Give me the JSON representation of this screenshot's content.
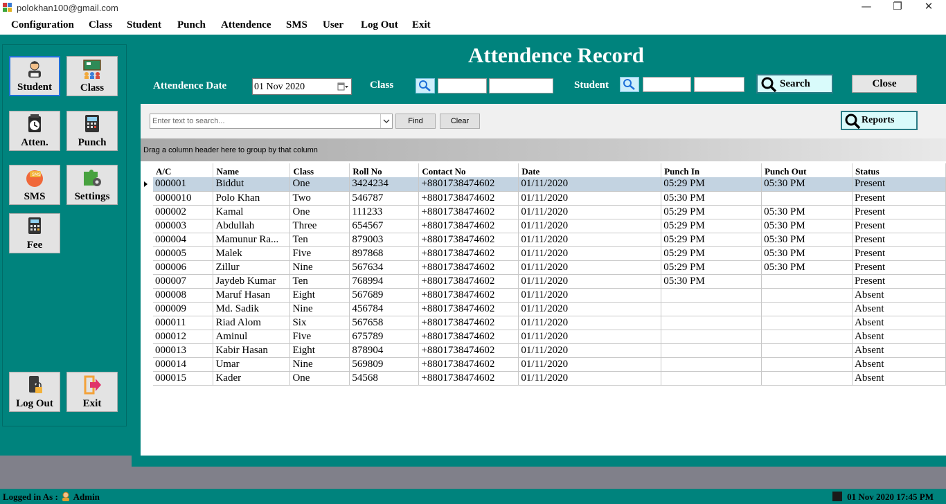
{
  "window": {
    "title": "polokhan100@gmail.com",
    "minimize": "—",
    "restore": "❐",
    "close": "✕"
  },
  "menu": [
    "Configuration",
    "Class",
    "Student",
    "Punch",
    "Attendence",
    "SMS",
    "User",
    "Log Out",
    "Exit"
  ],
  "sidebar": {
    "student": "Student",
    "class": "Class",
    "atten": "Atten.",
    "punch": "Punch",
    "sms": "SMS",
    "settings": "Settings",
    "fee": "Fee",
    "logout": "Log Out",
    "exit": "Exit"
  },
  "header": {
    "title": "Attendence Record",
    "date_label": "Attendence Date",
    "date_value": "01 Nov 2020",
    "class_label": "Class",
    "student_label": "Student",
    "search_button": "Search",
    "close_button": "Close"
  },
  "grid_toolbar": {
    "search_placeholder": "Enter text to search...",
    "find_button": "Find",
    "clear_button": "Clear",
    "reports_button": "Reports",
    "group_hint": "Drag a column header here to group by that column"
  },
  "table": {
    "columns": [
      "A/C",
      "Name",
      "Class",
      "Roll No",
      "Contact No",
      "Date",
      "Punch In",
      "Punch Out",
      "Status"
    ],
    "rows": [
      [
        "000001",
        "Biddut",
        "One",
        "3424234",
        "+8801738474602",
        "01/11/2020",
        "05:29 PM",
        "05:30 PM",
        "Present"
      ],
      [
        "0000010",
        "Polo Khan",
        "Two",
        "546787",
        "+8801738474602",
        "01/11/2020",
        "05:30 PM",
        "",
        "Present"
      ],
      [
        "000002",
        "Kamal",
        "One",
        "111233",
        "+8801738474602",
        "01/11/2020",
        "05:29 PM",
        "05:30 PM",
        "Present"
      ],
      [
        "000003",
        "Abdullah",
        "Three",
        "654567",
        "+8801738474602",
        "01/11/2020",
        "05:29 PM",
        "05:30 PM",
        "Present"
      ],
      [
        "000004",
        "Mamunur Ra...",
        "Ten",
        "879003",
        "+8801738474602",
        "01/11/2020",
        "05:29 PM",
        "05:30 PM",
        "Present"
      ],
      [
        "000005",
        "Malek",
        "Five",
        "897868",
        "+8801738474602",
        "01/11/2020",
        "05:29 PM",
        "05:30 PM",
        "Present"
      ],
      [
        "000006",
        "Zillur",
        "Nine",
        "567634",
        "+8801738474602",
        "01/11/2020",
        "05:29 PM",
        "05:30 PM",
        "Present"
      ],
      [
        "000007",
        "Jaydeb Kumar",
        "Ten",
        "768994",
        "+8801738474602",
        "01/11/2020",
        "05:30 PM",
        "",
        "Present"
      ],
      [
        "000008",
        "Maruf Hasan",
        "Eight",
        "567689",
        "+8801738474602",
        "01/11/2020",
        "",
        "",
        "Absent"
      ],
      [
        "000009",
        "Md. Sadik",
        "Nine",
        "456784",
        "+8801738474602",
        "01/11/2020",
        "",
        "",
        "Absent"
      ],
      [
        "000011",
        "Riad Alom",
        "Six",
        "567658",
        "+8801738474602",
        "01/11/2020",
        "",
        "",
        "Absent"
      ],
      [
        "000012",
        "Aminul",
        "Five",
        "675789",
        "+8801738474602",
        "01/11/2020",
        "",
        "",
        "Absent"
      ],
      [
        "000013",
        "Kabir Hasan",
        "Eight",
        "878904",
        "+8801738474602",
        "01/11/2020",
        "",
        "",
        "Absent"
      ],
      [
        "000014",
        "Umar",
        "Nine",
        "569809",
        "+8801738474602",
        "01/11/2020",
        "",
        "",
        "Absent"
      ],
      [
        "000015",
        "Kader",
        "One",
        "54568",
        "+8801738474602",
        "01/11/2020",
        "",
        "",
        "Absent"
      ]
    ]
  },
  "status": {
    "logged_in": "Logged in As : ",
    "user": "Admin",
    "datetime": "01 Nov 2020 17:45 PM"
  },
  "colors": {
    "teal": "#00837d",
    "selected_row": "#c3d3e1",
    "accent_button_bg": "#d9fbfb"
  }
}
